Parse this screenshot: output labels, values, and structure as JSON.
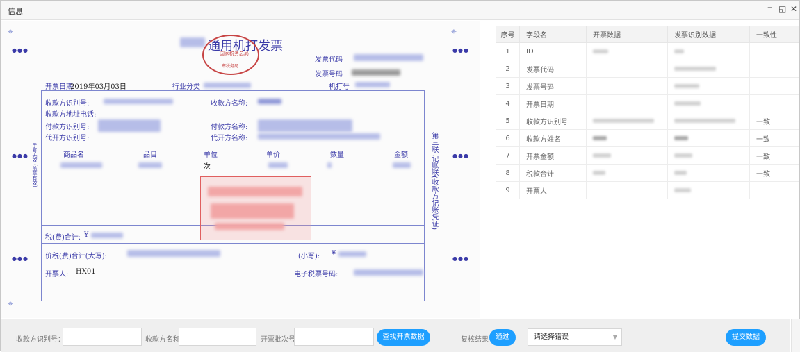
{
  "window": {
    "title": "信息",
    "minimize_icon": "minimize-icon",
    "maximize_icon": "maximize-icon",
    "close_icon": "close-icon"
  },
  "invoice": {
    "title_suffix": "通用机打发票",
    "seal_line1": "国家税务总局",
    "seal_line2": "市税务局",
    "invoice_code_label": "发票代码",
    "invoice_number_label": "发票号码",
    "issue_date_label": "开票日期",
    "issue_date": "2019年03月03日",
    "industry_label": "行业分类",
    "machine_number_label": "机打号",
    "payee_id_label": "收款方识别号:",
    "payee_name_label": "收款方名称:",
    "payee_address_label": "收款方地址电话:",
    "payer_id_label": "付款方识别号:",
    "payer_name_label": "付款方名称:",
    "agent_id_label": "代开方识别号:",
    "agent_name_label": "代开方名称:",
    "col_goods": "商品名",
    "col_item": "品目",
    "col_unit": "单位",
    "col_price": "单价",
    "col_qty": "数量",
    "col_amount": "金额",
    "unit_value": "次",
    "tax_total_label": "税(费)合计:",
    "tax_total_prefix": "¥",
    "total_caps_label": "价税(费)合计(大写):",
    "total_small_label": "(小写):",
    "total_small_prefix": "¥",
    "issuer_label": "开票人:",
    "issuer_value": "HX01",
    "e_tax_label": "电子税票号码:",
    "side_right": "第三联 记账联(收款方记账凭证)",
    "side_left": "手写无效 (盖章有效)"
  },
  "table": {
    "headers": [
      "序号",
      "字段名",
      "开票数据",
      "发票识别数据",
      "一致性"
    ],
    "rows": [
      {
        "no": "1",
        "field": "ID",
        "consistency": ""
      },
      {
        "no": "2",
        "field": "发票代码",
        "consistency": ""
      },
      {
        "no": "3",
        "field": "发票号码",
        "consistency": ""
      },
      {
        "no": "4",
        "field": "开票日期",
        "consistency": ""
      },
      {
        "no": "5",
        "field": "收款方识别号",
        "consistency": "一致"
      },
      {
        "no": "6",
        "field": "收款方姓名",
        "consistency": "一致"
      },
      {
        "no": "7",
        "field": "开票金额",
        "consistency": "一致"
      },
      {
        "no": "8",
        "field": "税款合计",
        "consistency": "一致"
      },
      {
        "no": "9",
        "field": "开票人",
        "consistency": ""
      }
    ]
  },
  "footer": {
    "payee_id_label": "收款方识别号：",
    "payee_id_value": "",
    "payee_name_label": "收款方名称",
    "payee_name_value": "",
    "batch_label": "开票批次号",
    "batch_value": "",
    "search_button": "查找开票数据",
    "review_label": "复核结果",
    "pass_button": "通过",
    "error_select": "请选择错误",
    "submit_button": "提交数据"
  }
}
